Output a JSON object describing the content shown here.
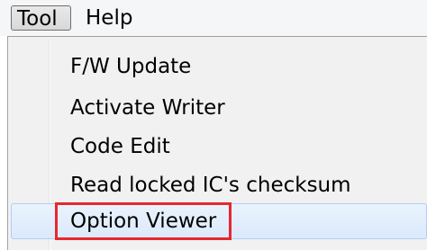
{
  "menubar": {
    "items": [
      {
        "label": "Tool"
      },
      {
        "label": "Help"
      }
    ]
  },
  "tool_menu": {
    "items": [
      {
        "label": "F/W Update"
      },
      {
        "label": "Activate Writer"
      },
      {
        "label": "Code Edit"
      },
      {
        "label": "Read locked IC's checksum"
      },
      {
        "label": "Option Viewer",
        "hovered": true
      }
    ]
  },
  "annotation": {
    "highlight_color": "#e8272f",
    "highlighted_item": "Option Viewer"
  }
}
